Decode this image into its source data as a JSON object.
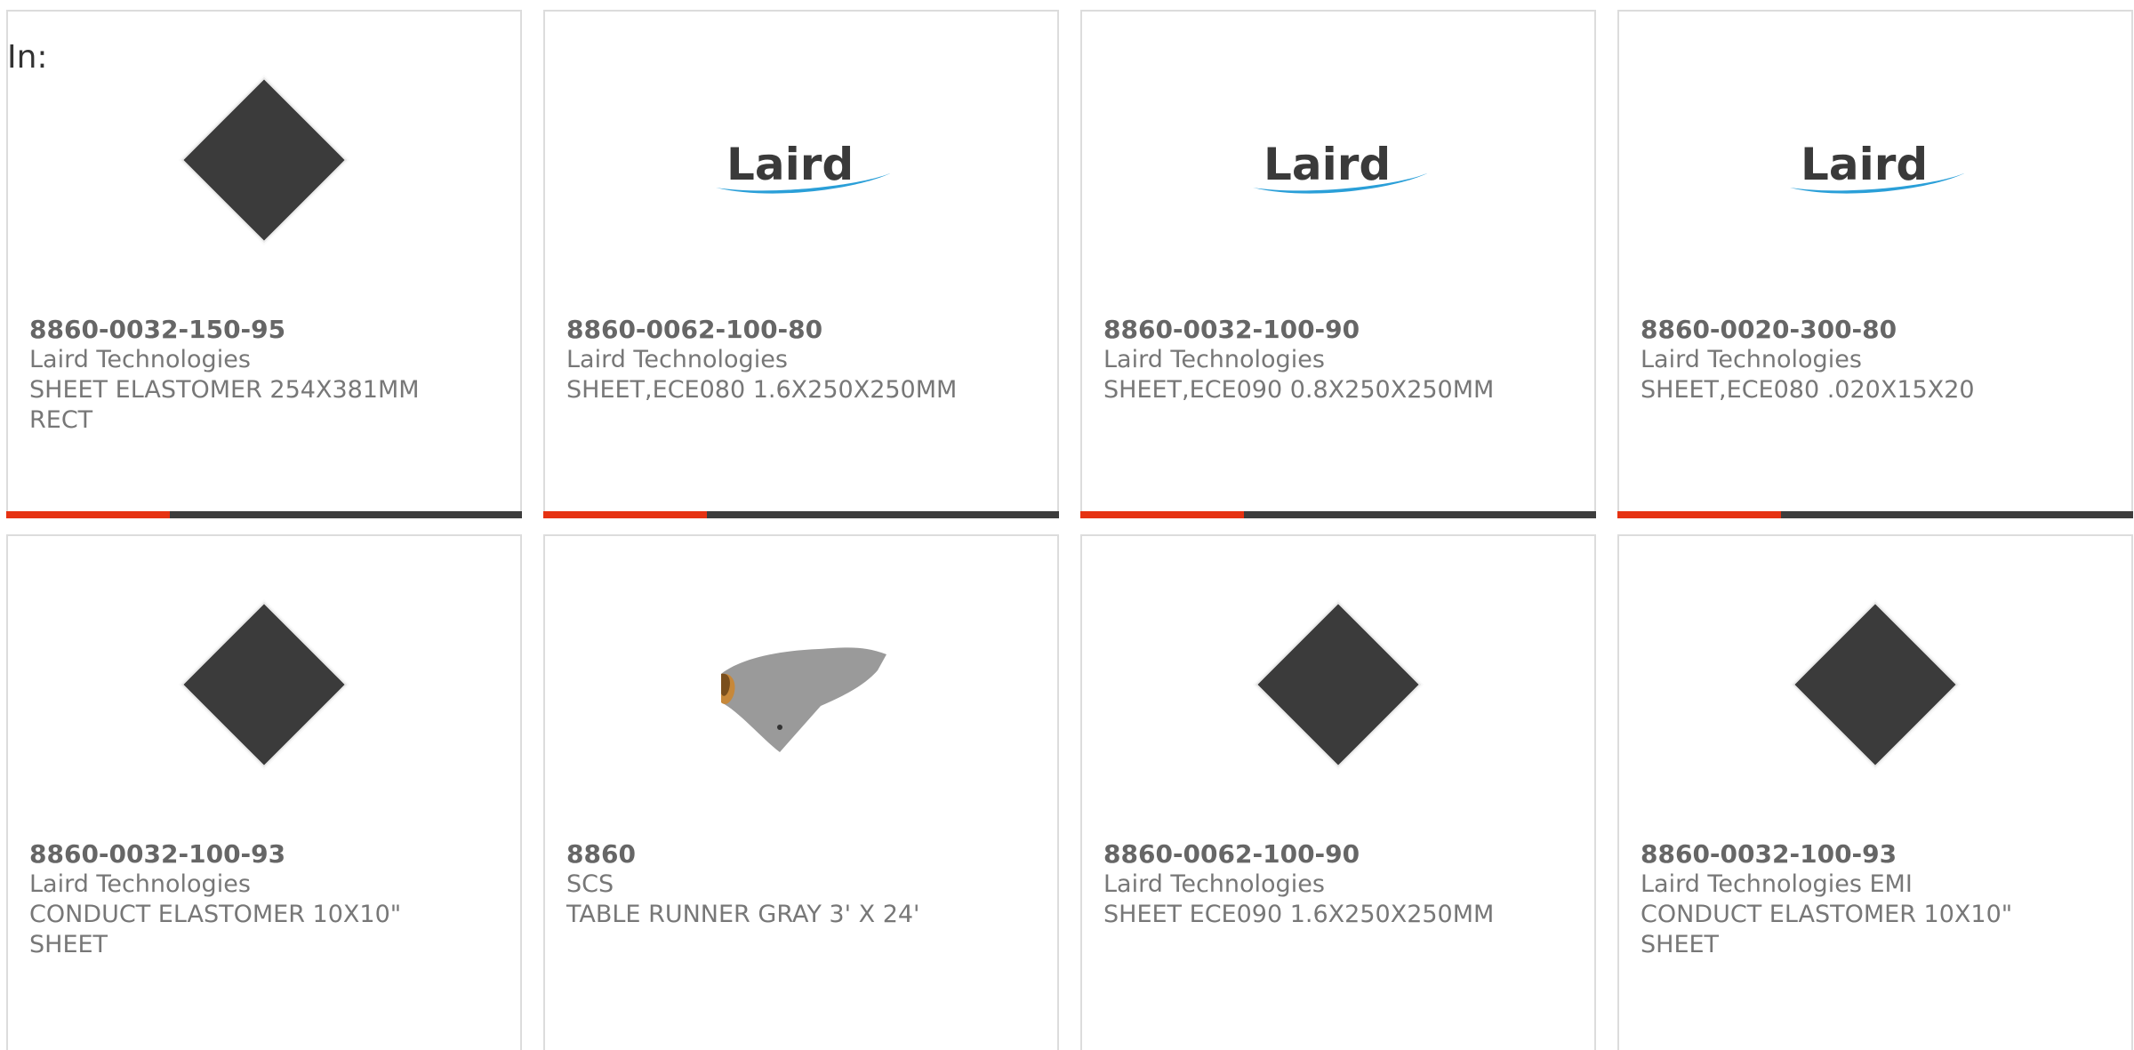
{
  "filter_label": "In:",
  "colors": {
    "accent": "#e63212",
    "bar": "#3d3d3d",
    "border": "#dcdcdc"
  },
  "products": [
    {
      "part": "8860-0032-150-95",
      "manufacturer": "Laird Technologies",
      "desc1": "SHEET ELASTOMER 254X381MM",
      "desc2": "RECT",
      "image": "black-sheet-icon"
    },
    {
      "part": "8860-0062-100-80",
      "manufacturer": "Laird Technologies",
      "desc1": "SHEET,ECE080 1.6X250X250MM",
      "desc2": "",
      "image": "laird-logo",
      "logo_text": "Laird"
    },
    {
      "part": "8860-0032-100-90",
      "manufacturer": "Laird Technologies",
      "desc1": "SHEET,ECE090 0.8X250X250MM",
      "desc2": "",
      "image": "laird-logo",
      "logo_text": "Laird"
    },
    {
      "part": "8860-0020-300-80",
      "manufacturer": "Laird Technologies",
      "desc1": "SHEET,ECE080 .020X15X20",
      "desc2": "",
      "image": "laird-logo",
      "logo_text": "Laird"
    },
    {
      "part": "8860-0032-100-93",
      "manufacturer": "Laird Technologies",
      "desc1": "CONDUCT ELASTOMER 10X10\"",
      "desc2": "SHEET",
      "image": "black-sheet-icon"
    },
    {
      "part": "8860",
      "manufacturer": "SCS",
      "desc1": "TABLE RUNNER GRAY 3' X 24'",
      "desc2": "",
      "image": "gray-mat-roll-icon"
    },
    {
      "part": "8860-0062-100-90",
      "manufacturer": "Laird Technologies",
      "desc1": "SHEET ECE090 1.6X250X250MM",
      "desc2": "",
      "image": "black-sheet-icon"
    },
    {
      "part": "8860-0032-100-93",
      "manufacturer": "Laird Technologies EMI",
      "desc1": "CONDUCT ELASTOMER 10X10\"",
      "desc2": "SHEET",
      "image": "black-sheet-icon"
    }
  ]
}
